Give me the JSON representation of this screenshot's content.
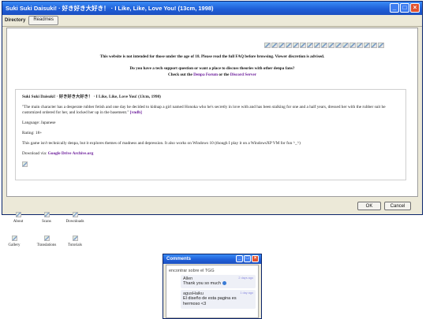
{
  "window": {
    "title": "Suki Suki Daisuki! · 好き好き大好き！ · I Like, Like, Love You! (13cm, 1998)",
    "toolbar_label": "Directory",
    "toolbar_button": "Readmes",
    "notice1": "This website is not intended for those under the age of 18. Please read the full FAQ before browsing. Viewer discretion is advised.",
    "notice2_pre": "Do you have a tech support question or want a place to discuss theories with other denpa fans? Check out the",
    "notice2_link1": "Denpa Forum",
    "notice2_mid": "or the",
    "notice2_link2": "Discord Server",
    "box": {
      "heading": "Suki Suki Daisuki! · 好き好き大好き！ · I Like, Like, Love You! (13cm, 1998)",
      "desc": "\"The main character has a desperate rubber fetish and one day he decided to kidnap a girl named Honoka who he's secretly in love with and has been stalking for one and a half years, dressed her with the rubber suit he customized ordered for her, and locked her up in the basement.\"",
      "desc_link": "[vndb]",
      "language": "Language: Japanese",
      "rating": "Rating: 18+",
      "note": "This game isn't technically denpa, but it explores themes of madness and depression. It also works on Windows 10 (though I play it on a WindowsXP VM for fun ^_^)",
      "download_pre": "Download via:",
      "download_link": "Google Drive Archive.org"
    },
    "ok": "OK",
    "cancel": "Cancel"
  },
  "desktop_icons": [
    {
      "label": "About"
    },
    {
      "label": "Scans"
    },
    {
      "label": "Downloads"
    },
    {
      "label": "Gallery"
    },
    {
      "label": "Translations"
    },
    {
      "label": "Tutorials"
    }
  ],
  "comments": {
    "title": "Comments",
    "cut_line": "encontrar sobre el TGG",
    "items": [
      {
        "user": "Allen",
        "time": "2 days ago",
        "text": "Thank you so much"
      },
      {
        "user": "agusHaiku",
        "time": "1 day ago",
        "text": "El diseño de esta pagina es hermoso <3"
      }
    ]
  }
}
